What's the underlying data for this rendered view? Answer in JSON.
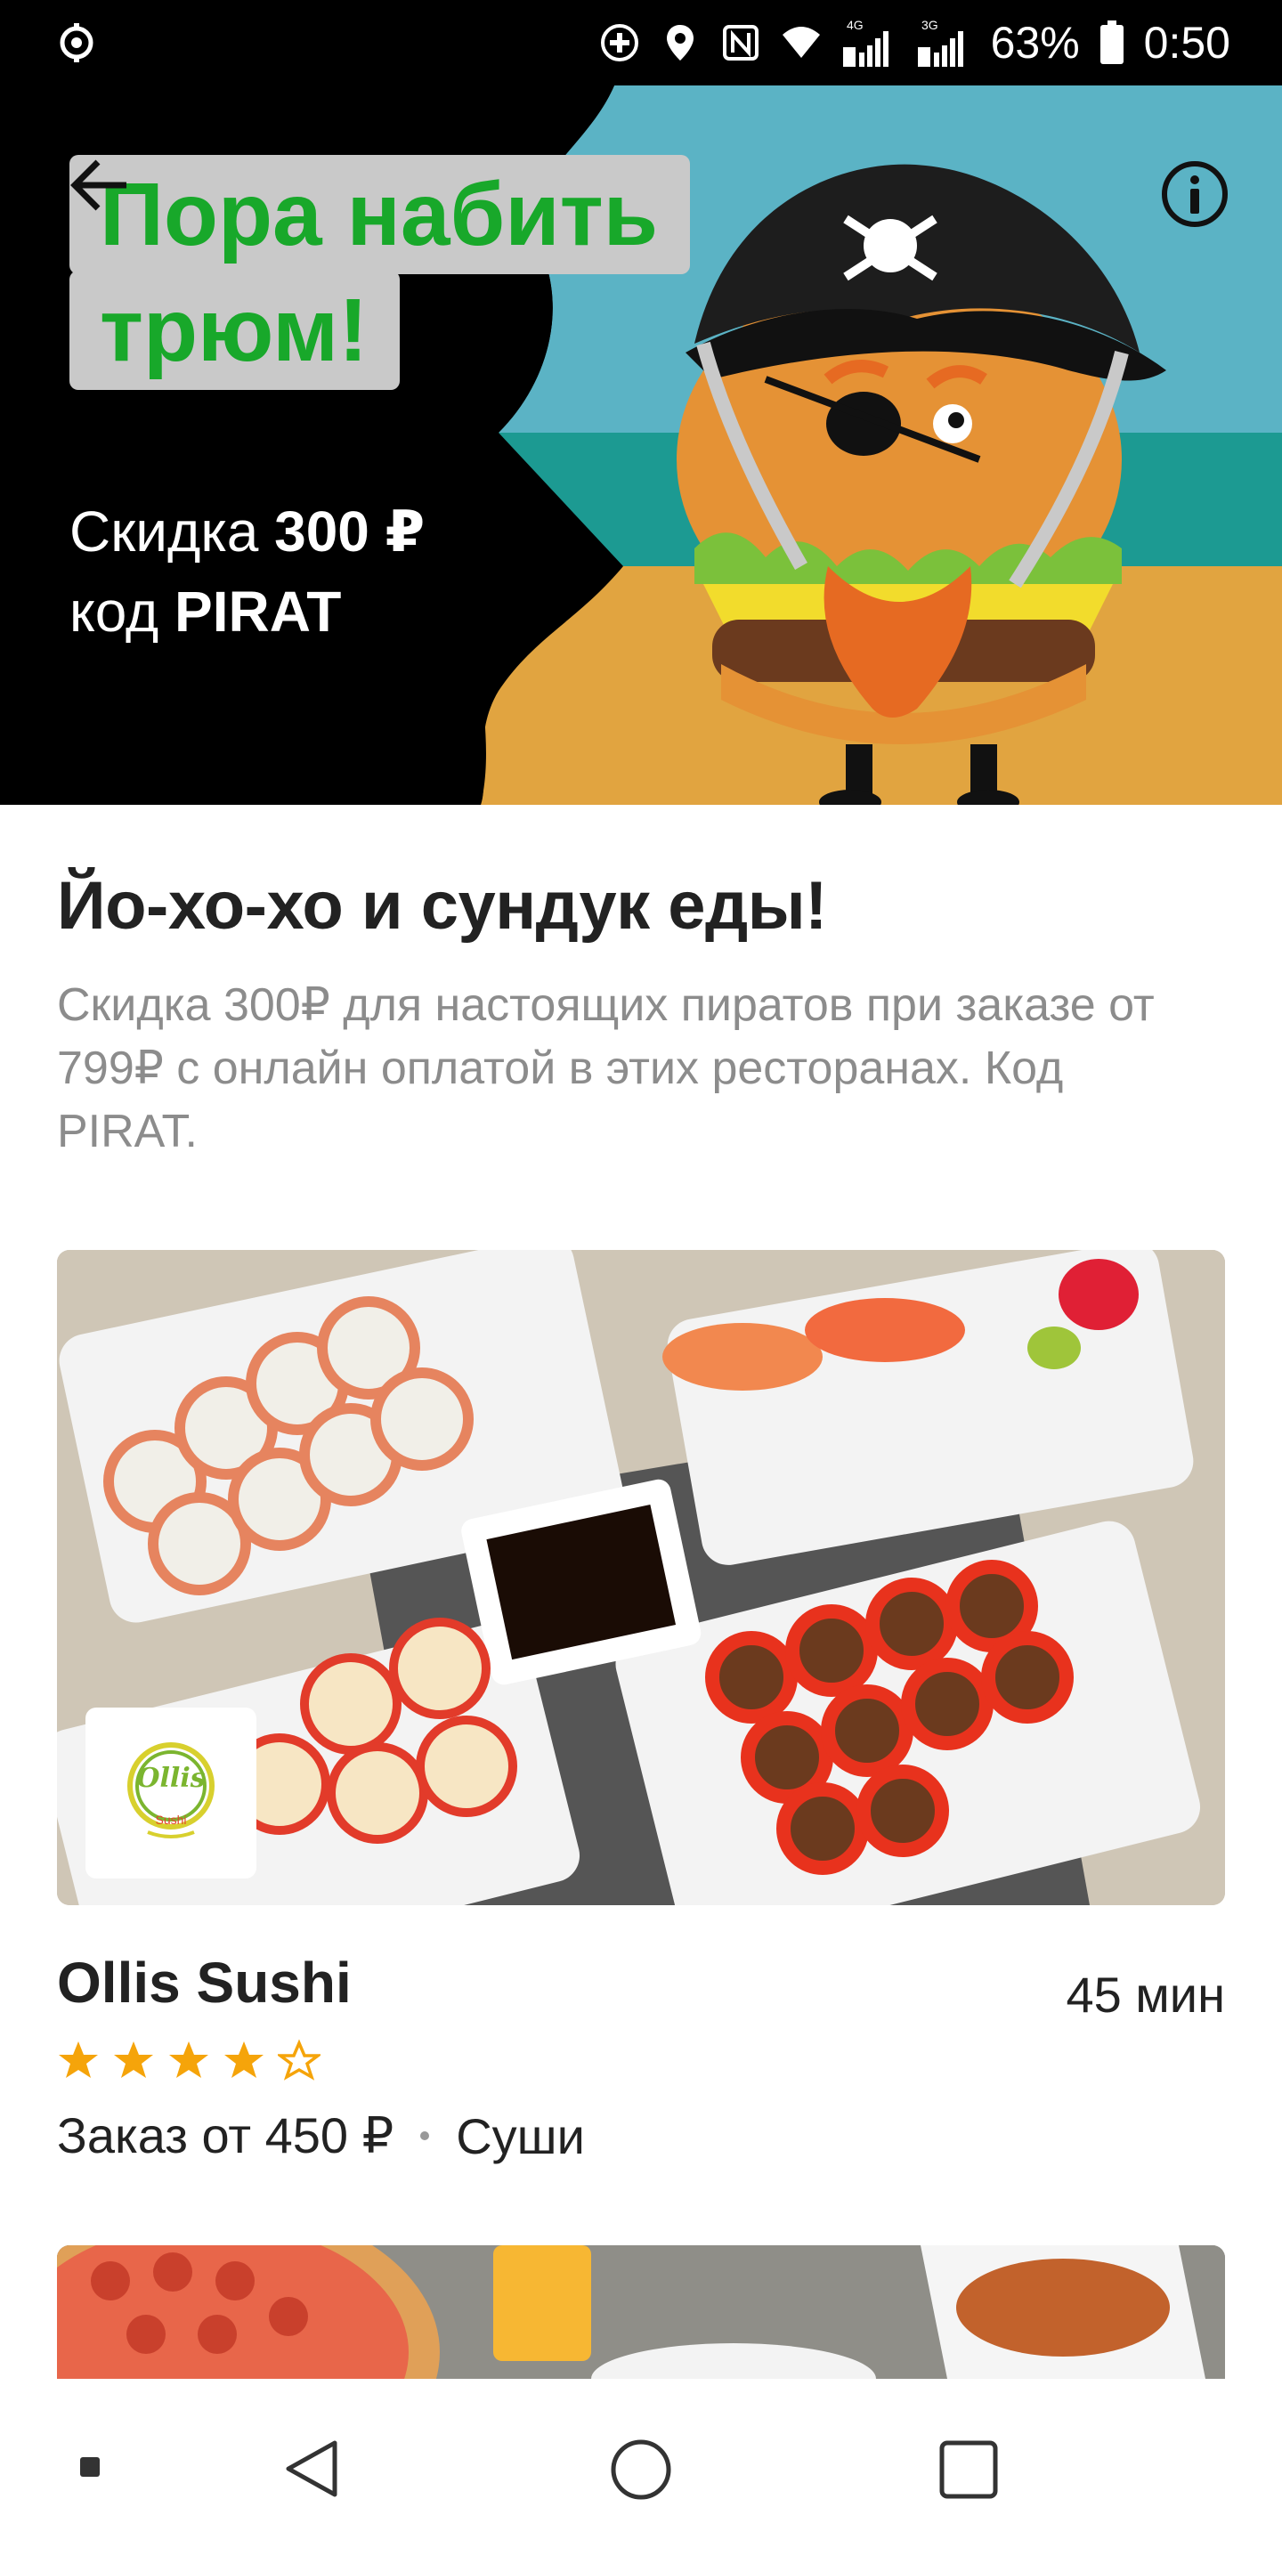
{
  "status_bar": {
    "battery_percent": "63%",
    "time": "0:50",
    "network_1": "4G",
    "network_2": "3G",
    "icons": [
      "app-icon",
      "add-circle-icon",
      "location-icon",
      "nfc-icon",
      "wifi-icon",
      "signal-sim1-icon",
      "signal-sim2-icon",
      "battery-icon"
    ]
  },
  "banner": {
    "headline_line1": "Пора набить",
    "headline_line2": "трюм!",
    "discount_prefix": "Скидка",
    "discount_value": "300 ₽",
    "code_prefix": "код",
    "code_value": "PIRAT",
    "colors": {
      "headline_green": "#18a82a",
      "sky": "#5bb3c5",
      "sea": "#1c9a92",
      "sand": "#e1a440"
    }
  },
  "promo": {
    "title": "Йо-хо-хо и сундук еды!",
    "description": "Скидка 300₽ для настоящих пиратов при заказе от 799₽ с онлайн оплатой в этих ресторанах. Код PIRAT."
  },
  "restaurant": {
    "name": "Ollis Sushi",
    "delivery_time": "45 мин",
    "rating": 4,
    "rating_max": 5,
    "min_order": "Заказ от 450 ₽",
    "cuisine": "Суши",
    "logo_text": "Ollis",
    "logo_sub": "Sushi",
    "star_color": "#f5a40a"
  }
}
